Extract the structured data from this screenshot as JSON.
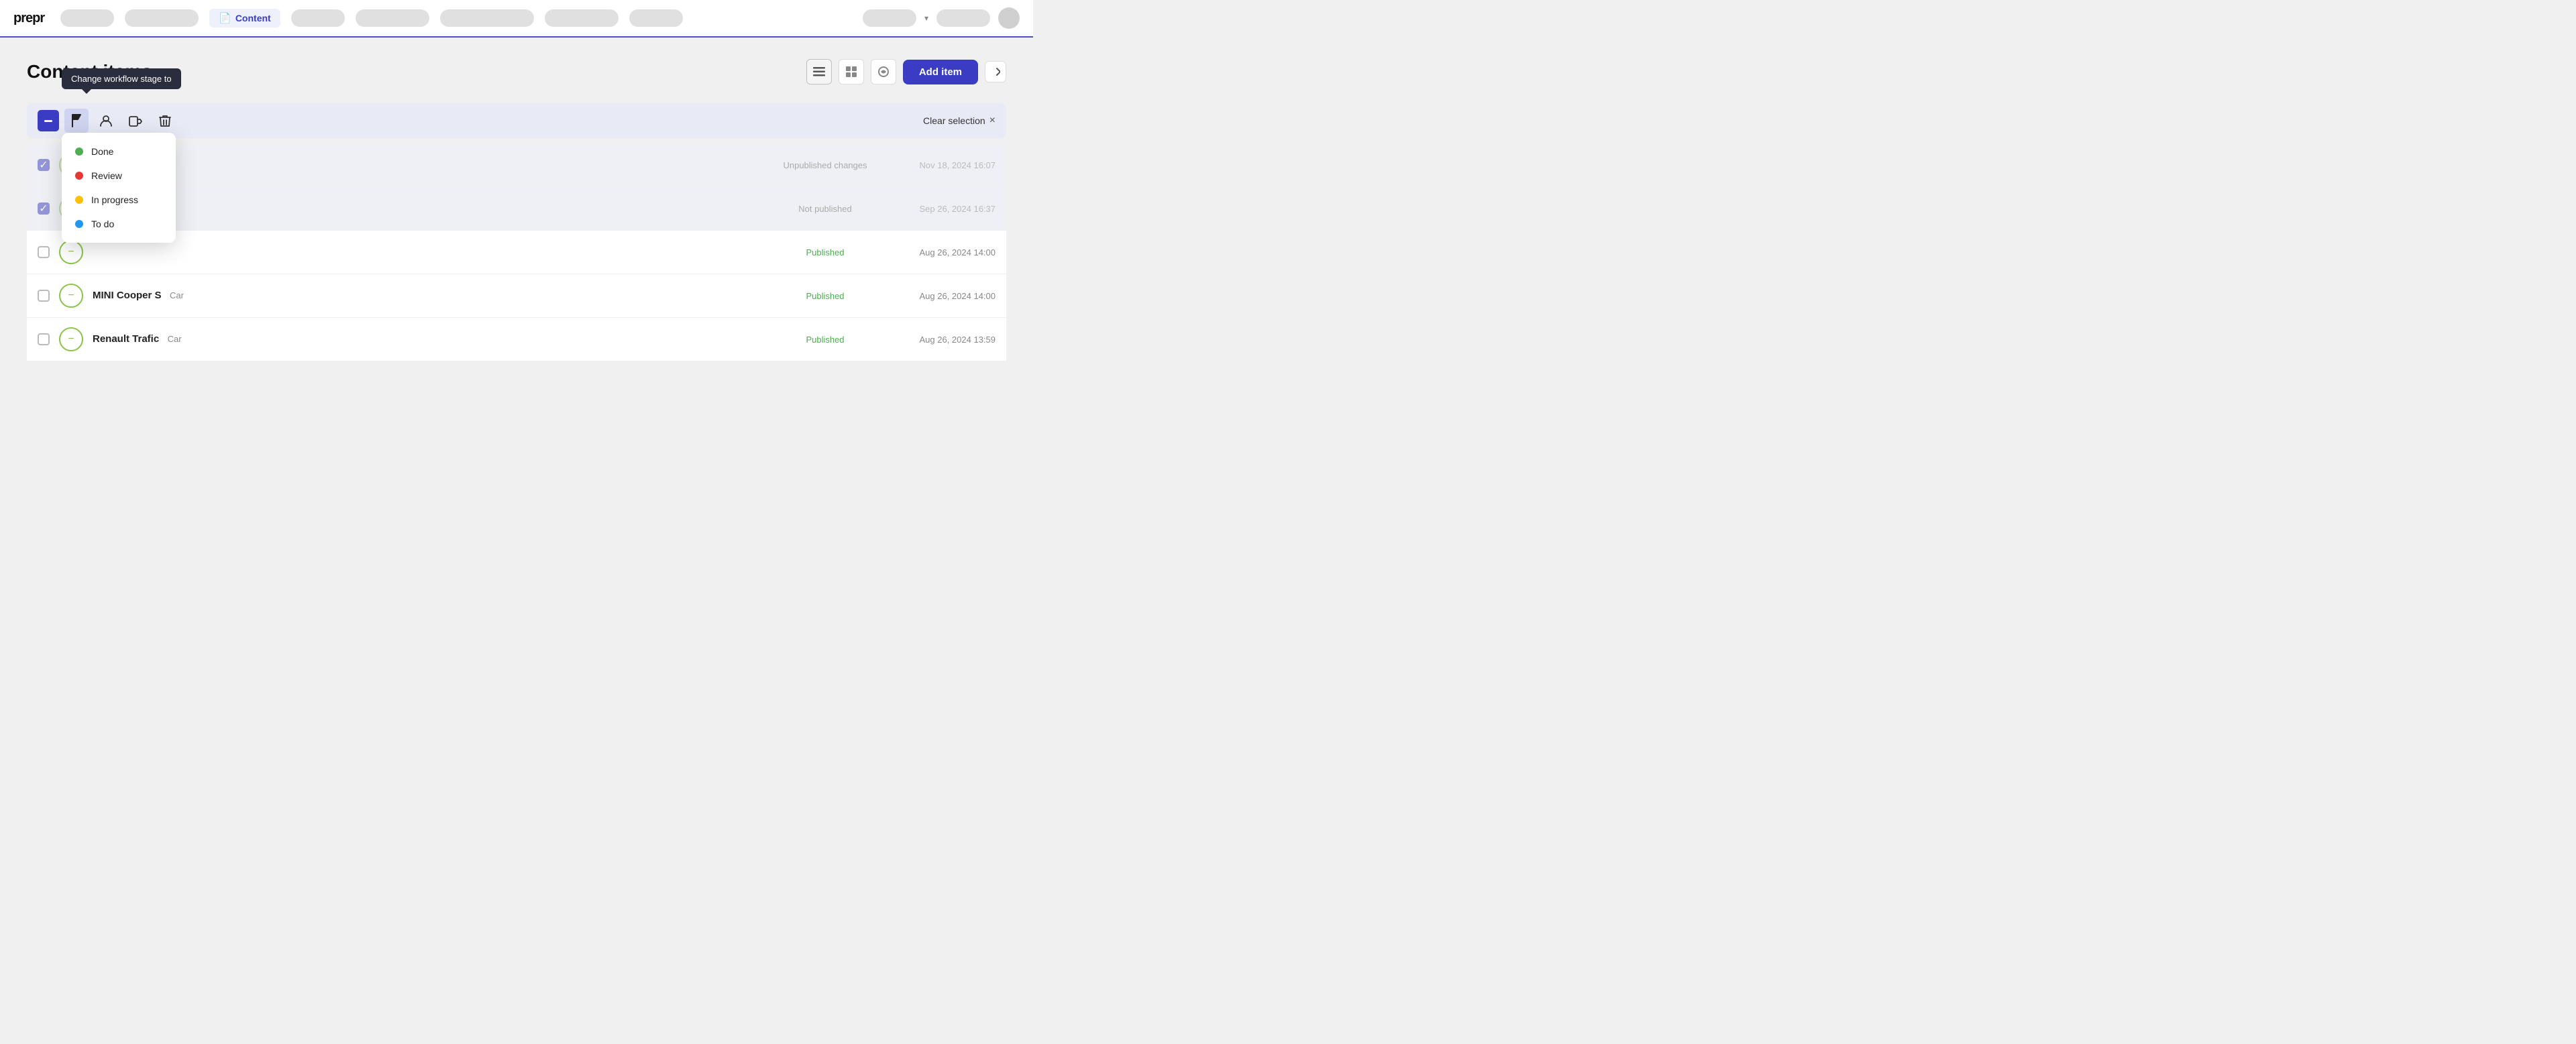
{
  "topbar": {
    "logo": "prepr",
    "active_tab": "Content",
    "doc_icon": "📄"
  },
  "page": {
    "title": "Content items",
    "add_button": "Add item"
  },
  "selection": {
    "clear_label": "Clear selection",
    "clear_x": "×"
  },
  "tooltip": {
    "text": "Change workflow stage to"
  },
  "workflow_options": [
    {
      "label": "Done",
      "color": "green"
    },
    {
      "label": "Review",
      "color": "red"
    },
    {
      "label": "In progress",
      "color": "yellow"
    },
    {
      "label": "To do",
      "color": "blue"
    }
  ],
  "table_rows": [
    {
      "id": 1,
      "checked": true,
      "name": "",
      "type": "",
      "status": "Unpublished changes",
      "date": "Nov 18, 2024 16:07",
      "selected": true
    },
    {
      "id": 2,
      "checked": true,
      "name": "",
      "type": "",
      "status": "Not published",
      "date": "Sep 26, 2024 16:37",
      "selected": true
    },
    {
      "id": 3,
      "checked": false,
      "name": "",
      "type": "",
      "status": "Published",
      "date": "Aug 26, 2024 14:00",
      "selected": false
    },
    {
      "id": 4,
      "checked": false,
      "name": "MINI Cooper S",
      "type": "Car",
      "status": "Published",
      "date": "Aug 26, 2024 14:00",
      "selected": false
    },
    {
      "id": 5,
      "checked": false,
      "name": "Renault Trafic",
      "type": "Car",
      "status": "Published",
      "date": "Aug 26, 2024 13:59",
      "selected": false
    }
  ]
}
